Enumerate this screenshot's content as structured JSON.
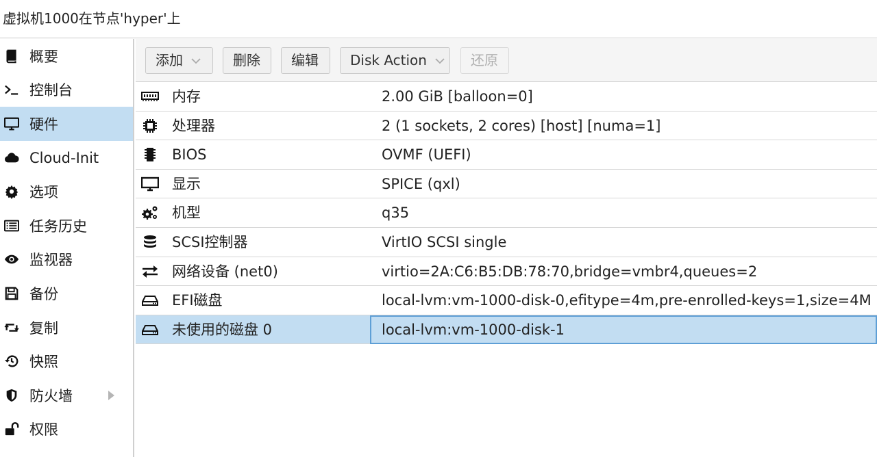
{
  "window": {
    "title": "虚拟机1000在节点'hyper'上"
  },
  "sidebar": {
    "items": [
      {
        "label": "概要",
        "icon": "book-icon"
      },
      {
        "label": "控制台",
        "icon": "terminal-icon"
      },
      {
        "label": "硬件",
        "icon": "desktop-icon",
        "selected": true
      },
      {
        "label": "Cloud-Init",
        "icon": "cloud-icon"
      },
      {
        "label": "选项",
        "icon": "gear-icon"
      },
      {
        "label": "任务历史",
        "icon": "list-icon"
      },
      {
        "label": "监视器",
        "icon": "eye-icon"
      },
      {
        "label": "备份",
        "icon": "floppy-icon"
      },
      {
        "label": "复制",
        "icon": "retweet-icon"
      },
      {
        "label": "快照",
        "icon": "history-icon"
      },
      {
        "label": "防火墙",
        "icon": "shield-icon",
        "expandable": true
      },
      {
        "label": "权限",
        "icon": "unlock-icon"
      }
    ]
  },
  "toolbar": {
    "add_label": "添加",
    "remove_label": "删除",
    "edit_label": "编辑",
    "disk_action_label": "Disk Action",
    "revert_label": "还原"
  },
  "hardware": {
    "rows": [
      {
        "name": "内存",
        "value": "2.00 GiB [balloon=0]",
        "icon": "memory-icon"
      },
      {
        "name": "处理器",
        "value": "2 (1 sockets, 2 cores) [host] [numa=1]",
        "icon": "cpu-icon"
      },
      {
        "name": "BIOS",
        "value": "OVMF (UEFI)",
        "icon": "chip-icon"
      },
      {
        "name": "显示",
        "value": "SPICE (qxl)",
        "icon": "monitor-icon"
      },
      {
        "name": "机型",
        "value": "q35",
        "icon": "cogs-icon"
      },
      {
        "name": "SCSI控制器",
        "value": "VirtIO SCSI single",
        "icon": "database-icon"
      },
      {
        "name": "网络设备 (net0)",
        "value": "virtio=2A:C6:B5:DB:78:70,bridge=vmbr4,queues=2",
        "icon": "exchange-icon"
      },
      {
        "name": "EFI磁盘",
        "value": "local-lvm:vm-1000-disk-0,efitype=4m,pre-enrolled-keys=1,size=4M",
        "icon": "hdd-icon"
      },
      {
        "name": "未使用的磁盘 0",
        "value": "local-lvm:vm-1000-disk-1",
        "icon": "hdd-icon",
        "selected": true
      }
    ]
  },
  "colors": {
    "selection": "#c2ddf2",
    "focus_border": "#5e9fd6"
  }
}
